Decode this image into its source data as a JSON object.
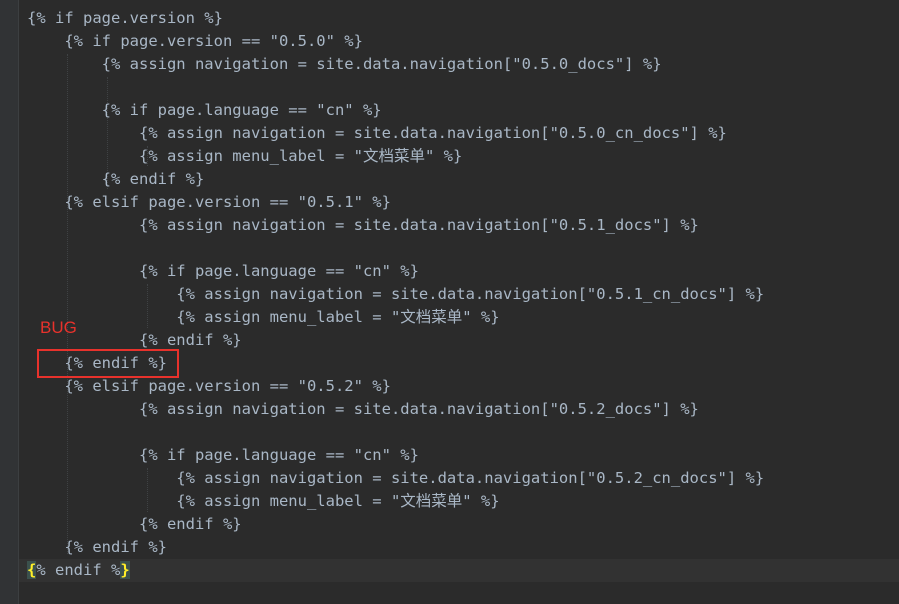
{
  "annotation": {
    "label": "BUG",
    "color": "#e8322c"
  },
  "theme": {
    "background": "#2b2b2b",
    "text": "#a9b7c6",
    "match_highlight": "#ffef28"
  },
  "code": {
    "lines": [
      "{% if page.version %}",
      "    {% if page.version == \"0.5.0\" %}",
      "        {% assign navigation = site.data.navigation[\"0.5.0_docs\"] %}",
      "",
      "        {% if page.language == \"cn\" %}",
      "            {% assign navigation = site.data.navigation[\"0.5.0_cn_docs\"] %}",
      "            {% assign menu_label = \"文档菜单\" %}",
      "        {% endif %}",
      "    {% elsif page.version == \"0.5.1\" %}",
      "            {% assign navigation = site.data.navigation[\"0.5.1_docs\"] %}",
      "",
      "            {% if page.language == \"cn\" %}",
      "                {% assign navigation = site.data.navigation[\"0.5.1_cn_docs\"] %}",
      "                {% assign menu_label = \"文档菜单\" %}",
      "            {% endif %}",
      "    {% endif %}",
      "    {% elsif page.version == \"0.5.2\" %}",
      "            {% assign navigation = site.data.navigation[\"0.5.2_docs\"] %}",
      "",
      "            {% if page.language == \"cn\" %}",
      "                {% assign navigation = site.data.navigation[\"0.5.2_cn_docs\"] %}",
      "                {% assign menu_label = \"文档菜单\" %}",
      "            {% endif %}",
      "    {% endif %}"
    ],
    "last_line": {
      "open": "{",
      "middle": "% endif %",
      "close": "}"
    }
  }
}
